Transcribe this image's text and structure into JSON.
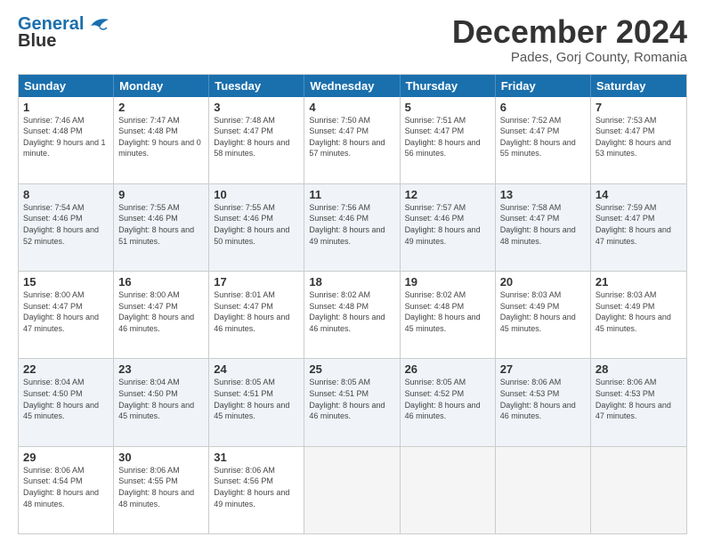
{
  "logo": {
    "line1": "General",
    "line2": "Blue"
  },
  "title": "December 2024",
  "subtitle": "Pades, Gorj County, Romania",
  "header_days": [
    "Sunday",
    "Monday",
    "Tuesday",
    "Wednesday",
    "Thursday",
    "Friday",
    "Saturday"
  ],
  "weeks": [
    [
      {
        "day": "1",
        "sunrise": "7:46 AM",
        "sunset": "4:48 PM",
        "daylight": "9 hours and 1 minute."
      },
      {
        "day": "2",
        "sunrise": "7:47 AM",
        "sunset": "4:48 PM",
        "daylight": "9 hours and 0 minutes."
      },
      {
        "day": "3",
        "sunrise": "7:48 AM",
        "sunset": "4:47 PM",
        "daylight": "8 hours and 58 minutes."
      },
      {
        "day": "4",
        "sunrise": "7:50 AM",
        "sunset": "4:47 PM",
        "daylight": "8 hours and 57 minutes."
      },
      {
        "day": "5",
        "sunrise": "7:51 AM",
        "sunset": "4:47 PM",
        "daylight": "8 hours and 56 minutes."
      },
      {
        "day": "6",
        "sunrise": "7:52 AM",
        "sunset": "4:47 PM",
        "daylight": "8 hours and 55 minutes."
      },
      {
        "day": "7",
        "sunrise": "7:53 AM",
        "sunset": "4:47 PM",
        "daylight": "8 hours and 53 minutes."
      }
    ],
    [
      {
        "day": "8",
        "sunrise": "7:54 AM",
        "sunset": "4:46 PM",
        "daylight": "8 hours and 52 minutes."
      },
      {
        "day": "9",
        "sunrise": "7:55 AM",
        "sunset": "4:46 PM",
        "daylight": "8 hours and 51 minutes."
      },
      {
        "day": "10",
        "sunrise": "7:55 AM",
        "sunset": "4:46 PM",
        "daylight": "8 hours and 50 minutes."
      },
      {
        "day": "11",
        "sunrise": "7:56 AM",
        "sunset": "4:46 PM",
        "daylight": "8 hours and 49 minutes."
      },
      {
        "day": "12",
        "sunrise": "7:57 AM",
        "sunset": "4:46 PM",
        "daylight": "8 hours and 49 minutes."
      },
      {
        "day": "13",
        "sunrise": "7:58 AM",
        "sunset": "4:47 PM",
        "daylight": "8 hours and 48 minutes."
      },
      {
        "day": "14",
        "sunrise": "7:59 AM",
        "sunset": "4:47 PM",
        "daylight": "8 hours and 47 minutes."
      }
    ],
    [
      {
        "day": "15",
        "sunrise": "8:00 AM",
        "sunset": "4:47 PM",
        "daylight": "8 hours and 47 minutes."
      },
      {
        "day": "16",
        "sunrise": "8:00 AM",
        "sunset": "4:47 PM",
        "daylight": "8 hours and 46 minutes."
      },
      {
        "day": "17",
        "sunrise": "8:01 AM",
        "sunset": "4:47 PM",
        "daylight": "8 hours and 46 minutes."
      },
      {
        "day": "18",
        "sunrise": "8:02 AM",
        "sunset": "4:48 PM",
        "daylight": "8 hours and 46 minutes."
      },
      {
        "day": "19",
        "sunrise": "8:02 AM",
        "sunset": "4:48 PM",
        "daylight": "8 hours and 45 minutes."
      },
      {
        "day": "20",
        "sunrise": "8:03 AM",
        "sunset": "4:49 PM",
        "daylight": "8 hours and 45 minutes."
      },
      {
        "day": "21",
        "sunrise": "8:03 AM",
        "sunset": "4:49 PM",
        "daylight": "8 hours and 45 minutes."
      }
    ],
    [
      {
        "day": "22",
        "sunrise": "8:04 AM",
        "sunset": "4:50 PM",
        "daylight": "8 hours and 45 minutes."
      },
      {
        "day": "23",
        "sunrise": "8:04 AM",
        "sunset": "4:50 PM",
        "daylight": "8 hours and 45 minutes."
      },
      {
        "day": "24",
        "sunrise": "8:05 AM",
        "sunset": "4:51 PM",
        "daylight": "8 hours and 45 minutes."
      },
      {
        "day": "25",
        "sunrise": "8:05 AM",
        "sunset": "4:51 PM",
        "daylight": "8 hours and 46 minutes."
      },
      {
        "day": "26",
        "sunrise": "8:05 AM",
        "sunset": "4:52 PM",
        "daylight": "8 hours and 46 minutes."
      },
      {
        "day": "27",
        "sunrise": "8:06 AM",
        "sunset": "4:53 PM",
        "daylight": "8 hours and 46 minutes."
      },
      {
        "day": "28",
        "sunrise": "8:06 AM",
        "sunset": "4:53 PM",
        "daylight": "8 hours and 47 minutes."
      }
    ],
    [
      {
        "day": "29",
        "sunrise": "8:06 AM",
        "sunset": "4:54 PM",
        "daylight": "8 hours and 48 minutes."
      },
      {
        "day": "30",
        "sunrise": "8:06 AM",
        "sunset": "4:55 PM",
        "daylight": "8 hours and 48 minutes."
      },
      {
        "day": "31",
        "sunrise": "8:06 AM",
        "sunset": "4:56 PM",
        "daylight": "8 hours and 49 minutes."
      },
      {
        "day": "",
        "sunrise": "",
        "sunset": "",
        "daylight": ""
      },
      {
        "day": "",
        "sunrise": "",
        "sunset": "",
        "daylight": ""
      },
      {
        "day": "",
        "sunrise": "",
        "sunset": "",
        "daylight": ""
      },
      {
        "day": "",
        "sunrise": "",
        "sunset": "",
        "daylight": ""
      }
    ]
  ]
}
